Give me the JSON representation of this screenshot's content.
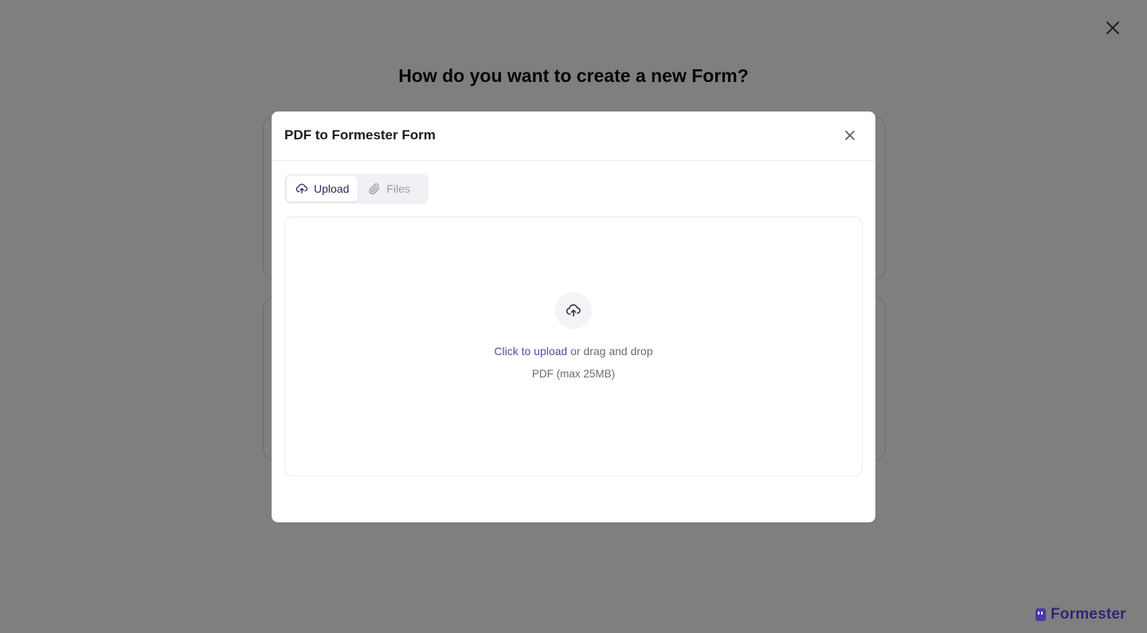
{
  "page": {
    "heading": "How do you want to create a new Form?"
  },
  "brand": {
    "name": "Formester",
    "color": "#2f2673"
  },
  "modal": {
    "title": "PDF to Formester Form",
    "tabs": [
      {
        "label": "Upload",
        "icon": "cloud-upload-icon",
        "active": true
      },
      {
        "label": "Files",
        "icon": "paperclip-icon",
        "active": false
      }
    ],
    "dropzone": {
      "icon": "cloud-upload-icon",
      "link_text": "Click to upload",
      "rest_text": " or drag and drop",
      "hint": "PDF (max 25MB)"
    }
  },
  "colors": {
    "overlay": "rgba(0,0,0,0.5)",
    "accent": "#5a45b0",
    "active_tab_text": "#2a2660"
  }
}
